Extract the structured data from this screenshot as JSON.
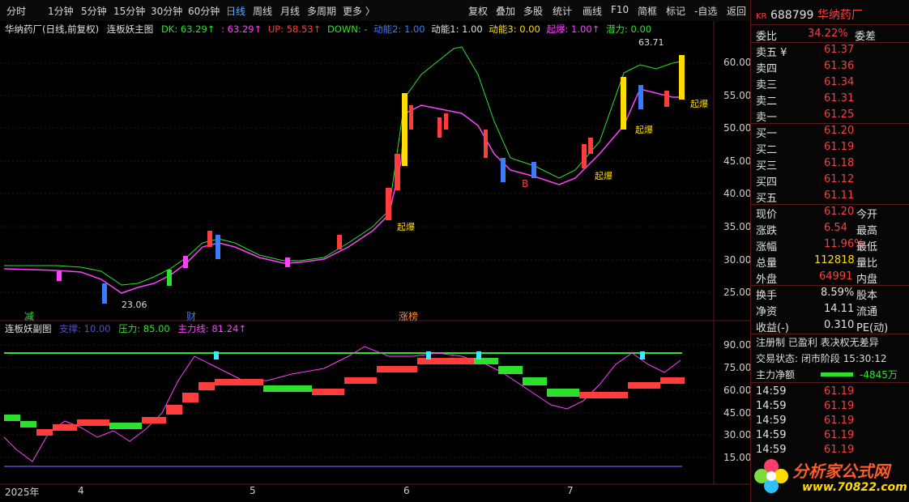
{
  "toolbar": {
    "left_items": [
      "分时",
      "1分钟",
      "5分钟",
      "15分钟",
      "30分钟",
      "60分钟",
      "日线",
      "周线",
      "月线",
      "多周期",
      "更多 〉"
    ],
    "right_items": [
      "复权",
      "叠加",
      "多股",
      "统计",
      "画线",
      "F10",
      "简框",
      "标记",
      "-自选",
      "返回"
    ],
    "selected": "日线"
  },
  "main_header": {
    "stock_label": "华纳药厂(日线,前复权)",
    "indicator_name": "连板妖主图",
    "dk": "DK: 63.29↑",
    "dk2": ": 63.29↑",
    "up": "UP: 58.53↑",
    "down": "DOWN: -",
    "dn2": "动能2: 1.00",
    "dn1": "动能1: 1.00",
    "dn3": "动能3: 0.00",
    "qibao": "起爆: 1.00↑",
    "qianli": "潜力: 0.00"
  },
  "main_axis": [
    "60.00",
    "55.00",
    "50.00",
    "45.00",
    "40.00",
    "35.00",
    "30.00",
    "25.00"
  ],
  "main_annotations": {
    "high": "63.71",
    "low": "23.06",
    "qibao_label": "起爆",
    "jian": "减",
    "cai": "财",
    "zhangbang": "涨榜",
    "b": "B"
  },
  "sub_header": {
    "name": "连板妖副图",
    "support": "支撑: 10.00",
    "pressure": "压力: 85.00",
    "main_line": "主力线: 81.24↑"
  },
  "sub_axis": [
    "90.00",
    "75.00",
    "60.00",
    "45.00",
    "30.00",
    "15.00"
  ],
  "x_axis": [
    "2025年",
    "4",
    "5",
    "6",
    "7"
  ],
  "quote": {
    "code": "688799",
    "name": "华纳药厂",
    "weibi_label": "委比",
    "weibi": "34.22%",
    "weicha_label": "委差",
    "asks": [
      {
        "label": "卖五 ¥",
        "price": "61.37"
      },
      {
        "label": "卖四",
        "price": "61.36"
      },
      {
        "label": "卖三",
        "price": "61.34"
      },
      {
        "label": "卖二",
        "price": "61.31"
      },
      {
        "label": "卖一",
        "price": "61.25"
      }
    ],
    "bids": [
      {
        "label": "买一",
        "price": "61.20"
      },
      {
        "label": "买二",
        "price": "61.19"
      },
      {
        "label": "买三",
        "price": "61.18"
      },
      {
        "label": "买四",
        "price": "61.12"
      },
      {
        "label": "买五",
        "price": "61.11"
      }
    ],
    "stats": [
      {
        "l1": "现价",
        "v1": "61.20",
        "l2": "今开"
      },
      {
        "l1": "涨跌",
        "v1": "6.54",
        "l2": "最高"
      },
      {
        "l1": "涨幅",
        "v1": "11.96%",
        "l2": "最低"
      },
      {
        "l1": "总量",
        "v1": "112818",
        "l2": "量比"
      },
      {
        "l1": "外盘",
        "v1": "64991",
        "l2": "内盘"
      },
      {
        "l1": "换手",
        "v1": "8.59%",
        "l2": "股本"
      },
      {
        "l1": "净资",
        "v1": "14.11",
        "l2": "流通"
      },
      {
        "l1": "收益(-)",
        "v1": "0.310",
        "l2": "PE(动)"
      }
    ],
    "tags": "注册制 已盈利 表决权无差异",
    "status": "交易状态: 闭市阶段 15:30:12",
    "net_label": "主力净额",
    "net_value": "-4845万",
    "ticks": [
      {
        "t": "14:59",
        "p": "61.19"
      },
      {
        "t": "14:59",
        "p": "61.19"
      },
      {
        "t": "14:59",
        "p": "61.19"
      },
      {
        "t": "14:59",
        "p": "61.19"
      },
      {
        "t": "14:59",
        "p": "61.19"
      },
      {
        "t": "14:59",
        "p": "61.19"
      }
    ]
  },
  "watermark": {
    "title": "分析家公式网",
    "url": "www.70822.com"
  },
  "colors": {
    "up": "#ff3d3d",
    "down": "#2ee02e",
    "accent": "#ffdc00",
    "blue": "#3a7bff",
    "magenta": "#ff40ff"
  }
}
